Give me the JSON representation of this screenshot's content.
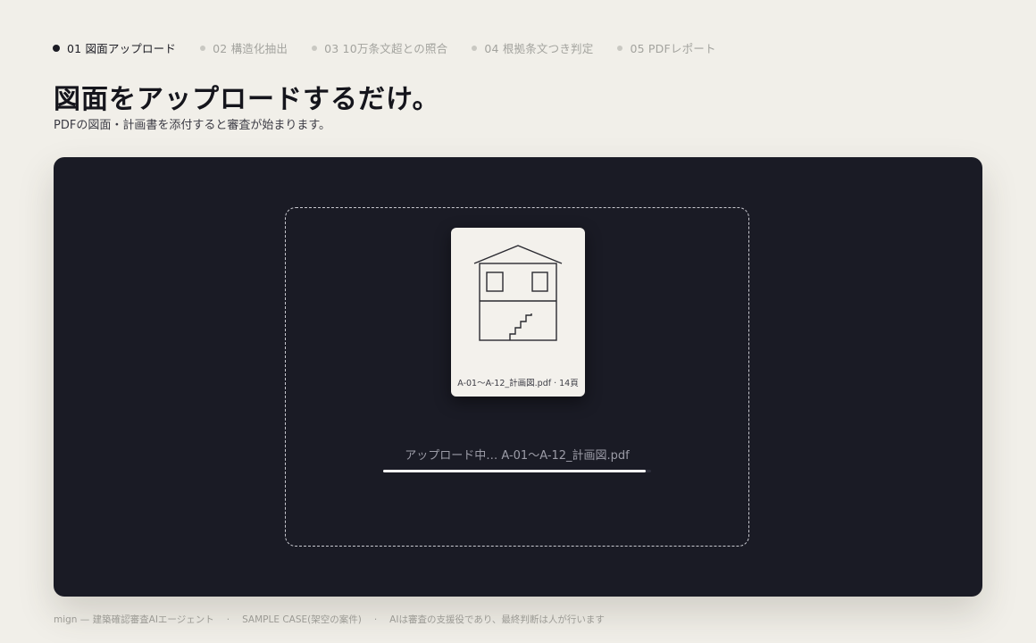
{
  "steps": [
    {
      "label": "01 図面アップロード",
      "active": true
    },
    {
      "label": "02 構造化抽出",
      "active": false
    },
    {
      "label": "03 10万条文超との照合",
      "active": false
    },
    {
      "label": "04 根拠条文つき判定",
      "active": false
    },
    {
      "label": "05 PDFレポート",
      "active": false
    }
  ],
  "header": {
    "title": "図面をアップロードするだけ。",
    "subtitle": "PDFの図面・計画書を添付すると審査が始まります。"
  },
  "upload": {
    "file_caption": "A-01〜A-12_計画図.pdf · 14頁",
    "status_text": "アップロード中… A-01〜A-12_計画図.pdf",
    "progress": 0.98,
    "thumbnail_icon": "house-drawing-icon"
  },
  "footer": {
    "brand": "mign — 建築確認審査AIエージェント",
    "case": "SAMPLE CASE(架空の案件)",
    "note": "AIは審査の支援役であり、最終判断は人が行います",
    "separator": "·"
  },
  "colors": {
    "background": "#f1efe9",
    "panel": "#1a1b25",
    "card": "#f3f1ec",
    "progress": "#ffffff"
  }
}
